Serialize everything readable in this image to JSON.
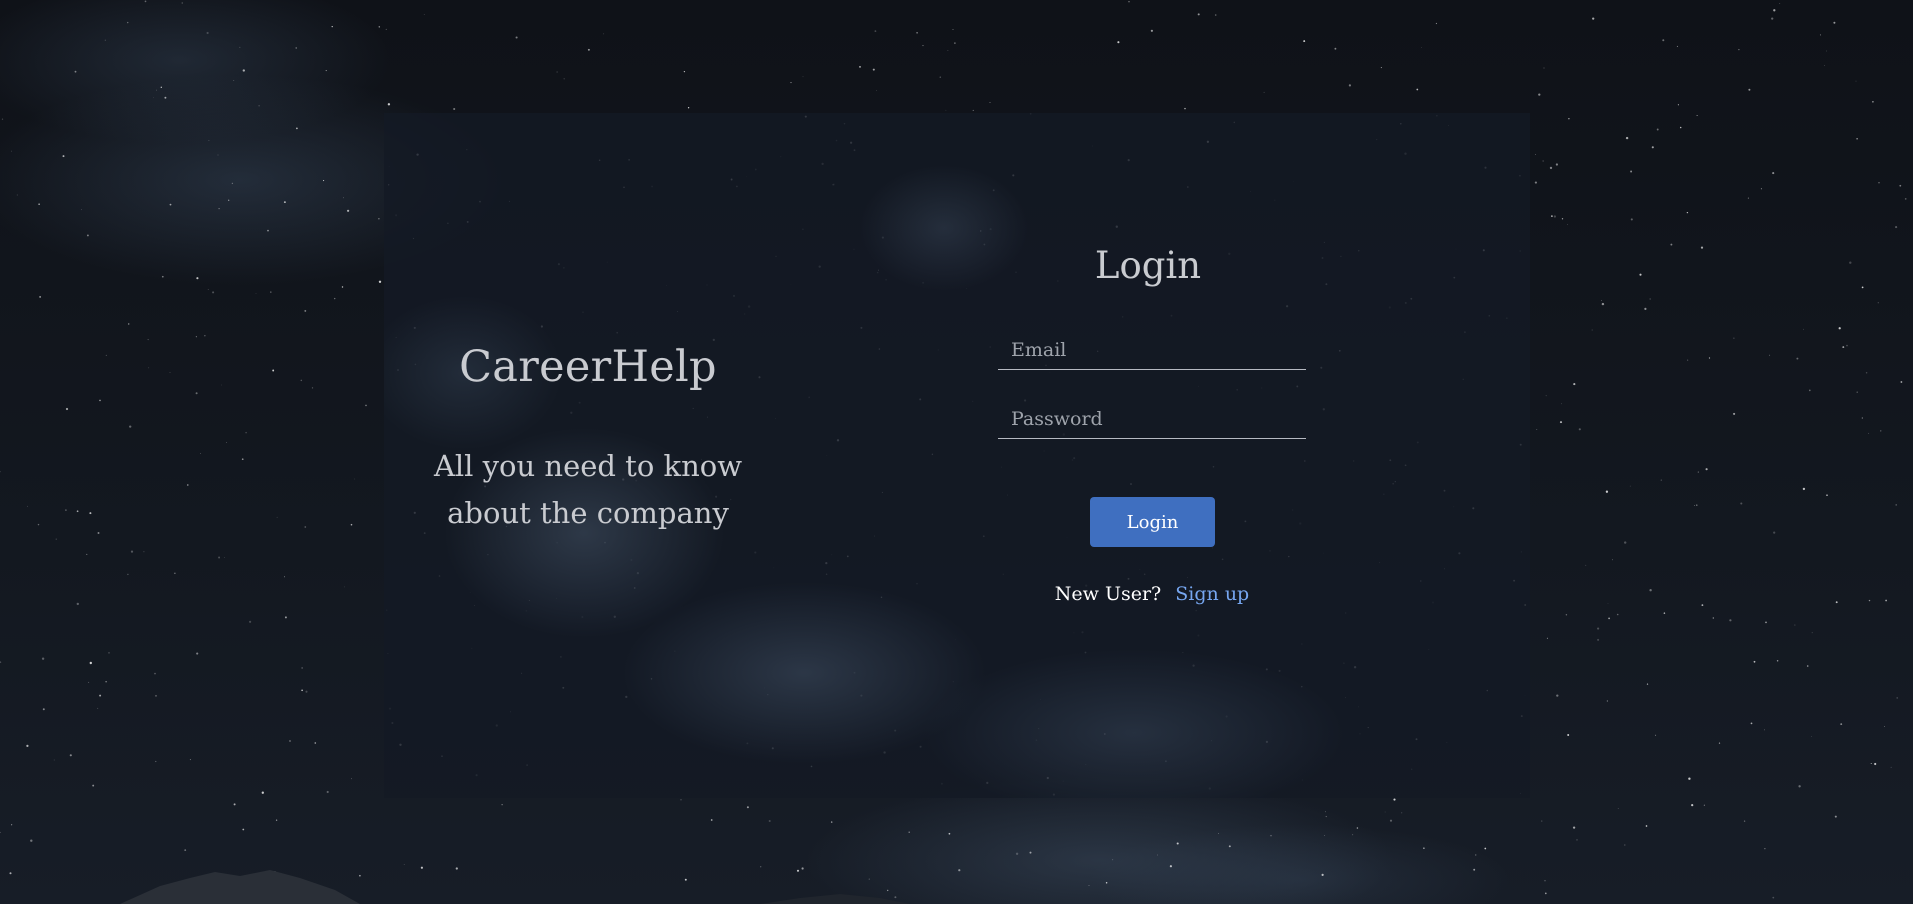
{
  "brand": {
    "title": "CareerHelp",
    "tagline": "All you need to know about the company"
  },
  "login_form": {
    "heading": "Login",
    "email_placeholder": "Email",
    "email_value": "",
    "password_placeholder": "Password",
    "password_value": "",
    "submit_label": "Login",
    "new_user_text": "New User?",
    "signup_label": "Sign up"
  },
  "colors": {
    "accent": "#3f6fc0",
    "link": "#76a6f0",
    "background": "#10141b",
    "text": "#c9cbd0"
  }
}
